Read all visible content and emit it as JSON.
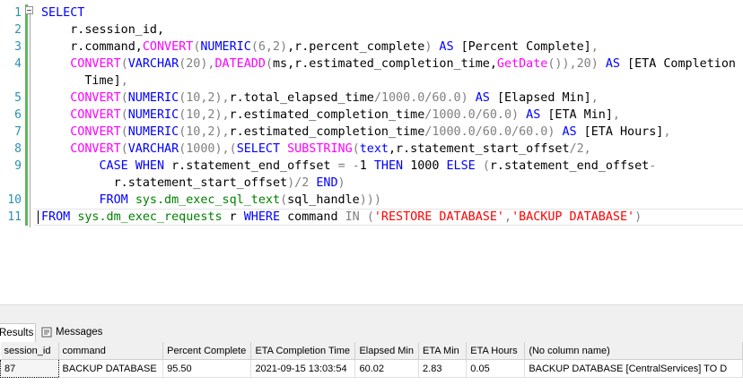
{
  "editor": {
    "line_numbers": [
      "1",
      "2",
      "3",
      "4",
      "",
      "5",
      "6",
      "7",
      "8",
      "9",
      "",
      "10",
      "11"
    ],
    "lines": [
      [
        {
          "t": "SELECT",
          "c": "kw"
        }
      ],
      [
        {
          "t": "    r.session_id,",
          "c": ""
        }
      ],
      [
        {
          "t": "    r.command,",
          "c": ""
        },
        {
          "t": "CONVERT",
          "c": "fn"
        },
        {
          "t": "(",
          "c": "op"
        },
        {
          "t": "NUMERIC",
          "c": "kw"
        },
        {
          "t": "(6,2)",
          "c": "op"
        },
        {
          "t": ",r.percent_complete",
          "c": ""
        },
        {
          "t": ")",
          "c": "op"
        },
        {
          "t": " AS ",
          "c": "kw"
        },
        {
          "t": "[Percent Complete]",
          "c": ""
        },
        {
          "t": ",",
          "c": "op"
        }
      ],
      [
        {
          "t": "    ",
          "c": ""
        },
        {
          "t": "CONVERT",
          "c": "fn"
        },
        {
          "t": "(",
          "c": "op"
        },
        {
          "t": "VARCHAR",
          "c": "kw"
        },
        {
          "t": "(20),",
          "c": "op"
        },
        {
          "t": "DATEADD",
          "c": "fn"
        },
        {
          "t": "(",
          "c": "op"
        },
        {
          "t": "ms,r.estimated_completion_time,",
          "c": ""
        },
        {
          "t": "GetDate",
          "c": "fn"
        },
        {
          "t": "()),20)",
          "c": "op"
        },
        {
          "t": " AS ",
          "c": "kw"
        },
        {
          "t": "[ETA Completion",
          "c": ""
        }
      ],
      [
        {
          "t": "      Time]",
          "c": ""
        },
        {
          "t": ",",
          "c": "op"
        }
      ],
      [
        {
          "t": "    ",
          "c": ""
        },
        {
          "t": "CONVERT",
          "c": "fn"
        },
        {
          "t": "(",
          "c": "op"
        },
        {
          "t": "NUMERIC",
          "c": "kw"
        },
        {
          "t": "(10,2),",
          "c": "op"
        },
        {
          "t": "r.total_elapsed_time",
          "c": ""
        },
        {
          "t": "/1000.0/60.0)",
          "c": "op"
        },
        {
          "t": " AS ",
          "c": "kw"
        },
        {
          "t": "[Elapsed Min]",
          "c": ""
        },
        {
          "t": ",",
          "c": "op"
        }
      ],
      [
        {
          "t": "    ",
          "c": ""
        },
        {
          "t": "CONVERT",
          "c": "fn"
        },
        {
          "t": "(",
          "c": "op"
        },
        {
          "t": "NUMERIC",
          "c": "kw"
        },
        {
          "t": "(10,2),",
          "c": "op"
        },
        {
          "t": "r.estimated_completion_time",
          "c": ""
        },
        {
          "t": "/1000.0/60.0)",
          "c": "op"
        },
        {
          "t": " AS ",
          "c": "kw"
        },
        {
          "t": "[ETA Min]",
          "c": ""
        },
        {
          "t": ",",
          "c": "op"
        }
      ],
      [
        {
          "t": "    ",
          "c": ""
        },
        {
          "t": "CONVERT",
          "c": "fn"
        },
        {
          "t": "(",
          "c": "op"
        },
        {
          "t": "NUMERIC",
          "c": "kw"
        },
        {
          "t": "(10,2),",
          "c": "op"
        },
        {
          "t": "r.estimated_completion_time",
          "c": ""
        },
        {
          "t": "/1000.0/60.0/60.0)",
          "c": "op"
        },
        {
          "t": " AS ",
          "c": "kw"
        },
        {
          "t": "[ETA Hours]",
          "c": ""
        },
        {
          "t": ",",
          "c": "op"
        }
      ],
      [
        {
          "t": "    ",
          "c": ""
        },
        {
          "t": "CONVERT",
          "c": "fn"
        },
        {
          "t": "(",
          "c": "op"
        },
        {
          "t": "VARCHAR",
          "c": "kw"
        },
        {
          "t": "(1000),(",
          "c": "op"
        },
        {
          "t": "SELECT ",
          "c": "kw"
        },
        {
          "t": "SUBSTRING",
          "c": "fn"
        },
        {
          "t": "(",
          "c": "op"
        },
        {
          "t": "text",
          "c": "kw"
        },
        {
          "t": ",r.statement_start_offset",
          "c": ""
        },
        {
          "t": "/2,",
          "c": "op"
        }
      ],
      [
        {
          "t": "        ",
          "c": ""
        },
        {
          "t": "CASE WHEN ",
          "c": "kw"
        },
        {
          "t": "r.statement_end_offset ",
          "c": ""
        },
        {
          "t": "= -",
          "c": "op"
        },
        {
          "t": "1 ",
          "c": ""
        },
        {
          "t": "THEN ",
          "c": "kw"
        },
        {
          "t": "1000 ",
          "c": ""
        },
        {
          "t": "ELSE ",
          "c": "kw"
        },
        {
          "t": "(",
          "c": "op"
        },
        {
          "t": "r.statement_end_offset",
          "c": ""
        },
        {
          "t": "-",
          "c": "op"
        }
      ],
      [
        {
          "t": "          r.statement_start_offset",
          "c": ""
        },
        {
          "t": ")/2 ",
          "c": "op"
        },
        {
          "t": "END",
          "c": "kw"
        },
        {
          "t": ")",
          "c": "op"
        }
      ],
      [
        {
          "t": "        ",
          "c": ""
        },
        {
          "t": "FROM ",
          "c": "kw"
        },
        {
          "t": "sys.dm_exec_sql_text",
          "c": "sys"
        },
        {
          "t": "(",
          "c": "op"
        },
        {
          "t": "sql_handle",
          "c": ""
        },
        {
          "t": ")))",
          "c": "op"
        }
      ],
      [
        {
          "t": "FROM ",
          "c": "kw"
        },
        {
          "t": "sys.dm_exec_requests ",
          "c": "sys"
        },
        {
          "t": "r ",
          "c": ""
        },
        {
          "t": "WHERE ",
          "c": "kw"
        },
        {
          "t": "command ",
          "c": ""
        },
        {
          "t": "IN ",
          "c": "op"
        },
        {
          "t": "(",
          "c": "op"
        },
        {
          "t": "'RESTORE DATABASE'",
          "c": "str"
        },
        {
          "t": ",",
          "c": "op"
        },
        {
          "t": "'BACKUP DATABASE'",
          "c": "str"
        },
        {
          "t": ")",
          "c": "op"
        }
      ]
    ]
  },
  "tabs": {
    "results_label": "Results",
    "messages_label": "Messages"
  },
  "grid": {
    "columns": [
      "session_id",
      "command",
      "Percent Complete",
      "ETA Completion Time",
      "Elapsed Min",
      "ETA Min",
      "ETA Hours",
      "(No column name)"
    ],
    "rows": [
      [
        "87",
        "BACKUP DATABASE",
        "95.50",
        "2021-09-15 13:03:54",
        "60.02",
        "2.83",
        "0.05",
        "BACKUP DATABASE [CentralServices] TO  D"
      ]
    ]
  },
  "colors": {
    "keyword": "#0000ff",
    "function": "#ff00ff",
    "operator": "#808080",
    "string": "#ff0000",
    "system_object": "#008000",
    "line_number": "#2b91af"
  }
}
